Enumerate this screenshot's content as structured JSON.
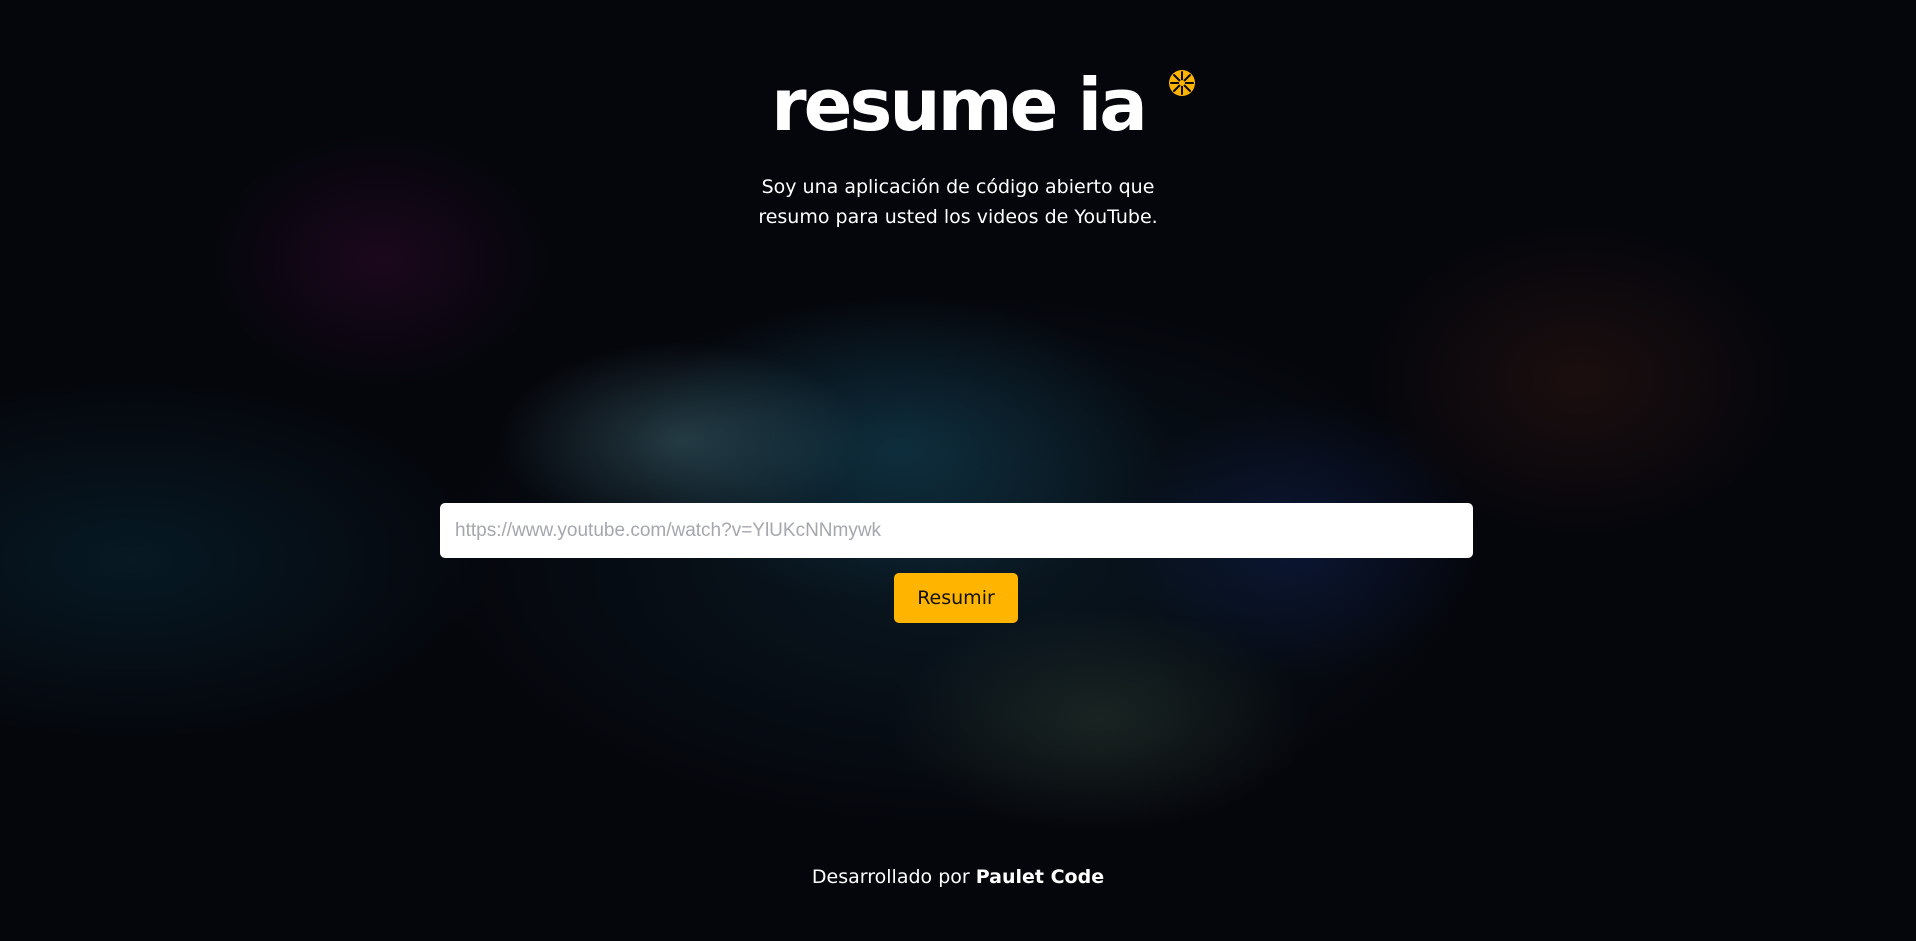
{
  "brand": {
    "logo_text": "resume ia",
    "logo_icon": "star-burst-icon",
    "accent_color": "#ffb500"
  },
  "hero": {
    "tagline": "Soy una aplicación de código abierto que resumo para usted los videos de YouTube."
  },
  "form": {
    "url_placeholder": "https://www.youtube.com/watch?v=YlUKcNNmywk",
    "url_value": "",
    "submit_label": "Resumir"
  },
  "footer": {
    "prefix": "Desarrollado por",
    "author": "Paulet Code"
  }
}
